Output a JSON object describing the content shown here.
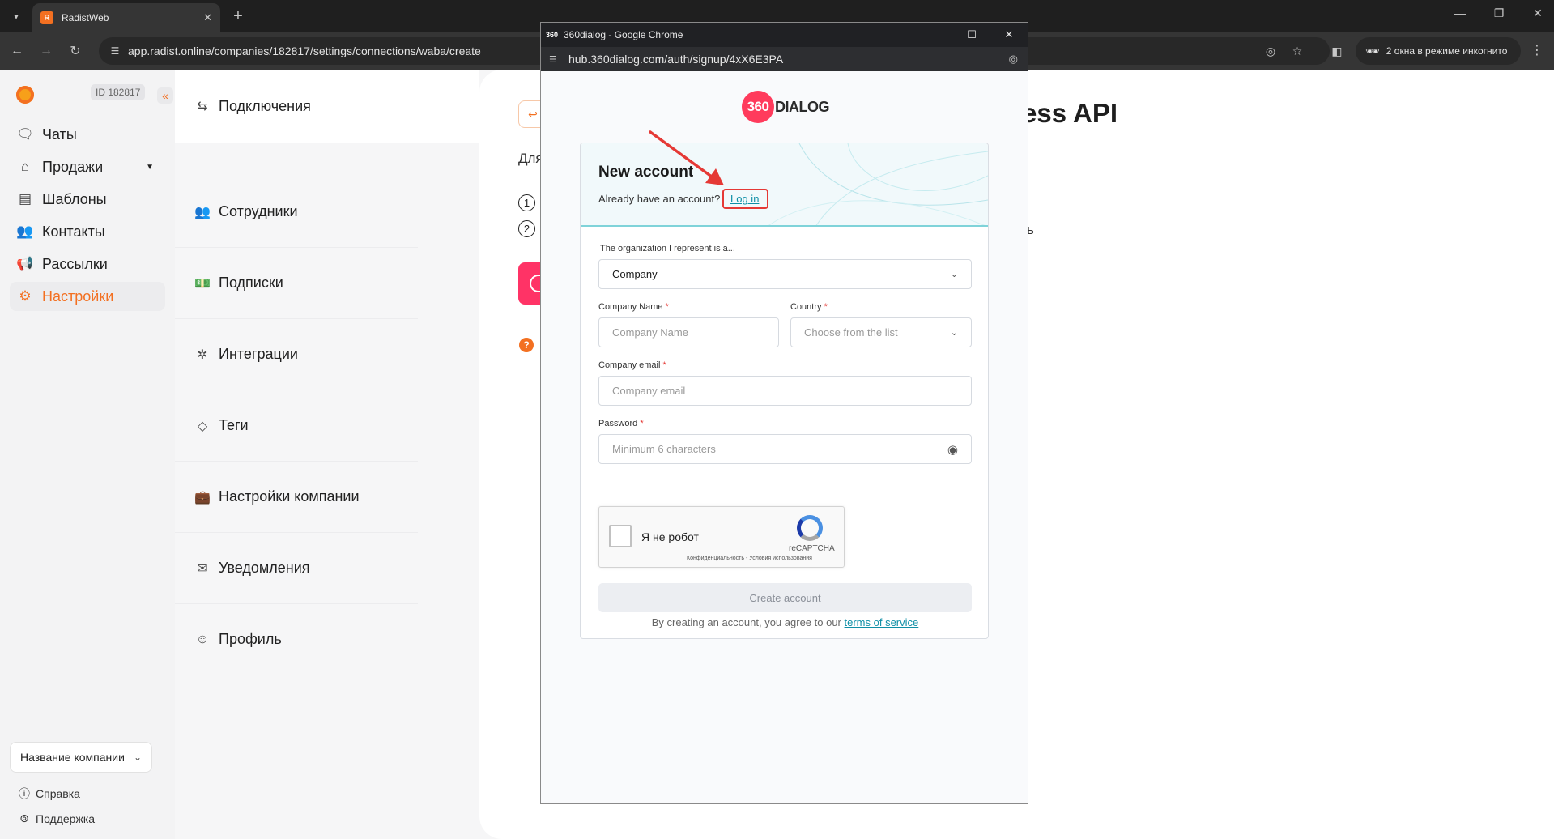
{
  "browser": {
    "tab_title": "RadistWeb",
    "tab_favicon": "R",
    "url": "app.radist.online/companies/182817/settings/connections/waba/create",
    "incognito_label": "2 окна в режиме инкогнито"
  },
  "sidebar": {
    "company_id": "ID 182817",
    "items": [
      {
        "label": "Чаты",
        "icon": "chat-icon"
      },
      {
        "label": "Продажи",
        "icon": "store-icon"
      },
      {
        "label": "Шаблоны",
        "icon": "document-icon"
      },
      {
        "label": "Контакты",
        "icon": "contacts-icon"
      },
      {
        "label": "Рассылки",
        "icon": "megaphone-icon"
      },
      {
        "label": "Настройки",
        "icon": "gear-icon",
        "active": true
      }
    ],
    "company_select": "Название компании",
    "help": "Справка",
    "support": "Поддержка",
    "accent_color": "#f37021"
  },
  "settings_menu": {
    "items": [
      {
        "label": "Подключения",
        "icon": "arrows-icon"
      },
      {
        "label": "Сотрудники",
        "icon": "users-icon"
      },
      {
        "label": "Подписки",
        "icon": "cash-icon"
      },
      {
        "label": "Интеграции",
        "icon": "puzzle-icon"
      },
      {
        "label": "Теги",
        "icon": "tag-icon"
      },
      {
        "label": "Настройки компании",
        "icon": "briefcase-icon"
      },
      {
        "label": "Уведомления",
        "icon": "mail-icon"
      },
      {
        "label": "Профиль",
        "icon": "ghost-icon"
      }
    ]
  },
  "page": {
    "title_fragment": "ess API",
    "text_fragment": "Для",
    "step_1": "1",
    "step_2": "2",
    "letter_fragment": "ь",
    "help_mark": "?"
  },
  "popup": {
    "window_title": "360dialog - Google Chrome",
    "url": "hub.360dialog.com/auth/signup/4xX6E3PA",
    "logo_number": "360",
    "logo_word": "DIALOG",
    "card_title": "New account",
    "already_text": "Already have an account?",
    "login_link": "Log in",
    "org_label": "The organization I represent is a...",
    "org_value": "Company",
    "company_name_label": "Company Name",
    "company_name_placeholder": "Company Name",
    "country_label": "Country",
    "country_placeholder": "Choose from the list",
    "email_label": "Company email",
    "email_placeholder": "Company email",
    "password_label": "Password",
    "password_placeholder": "Minimum 6 characters",
    "required_mark": "*",
    "captcha_label": "Я не робот",
    "captcha_brand": "reCAPTCHA",
    "captcha_terms": "Конфиденциальность - Условия использования",
    "submit_label": "Create account",
    "tos_text": "By creating an account, you agree to our",
    "tos_link": "terms of service",
    "brand_color": "#ff3b5c",
    "link_color": "#0f8fa6",
    "annotation_color": "#e53935"
  }
}
